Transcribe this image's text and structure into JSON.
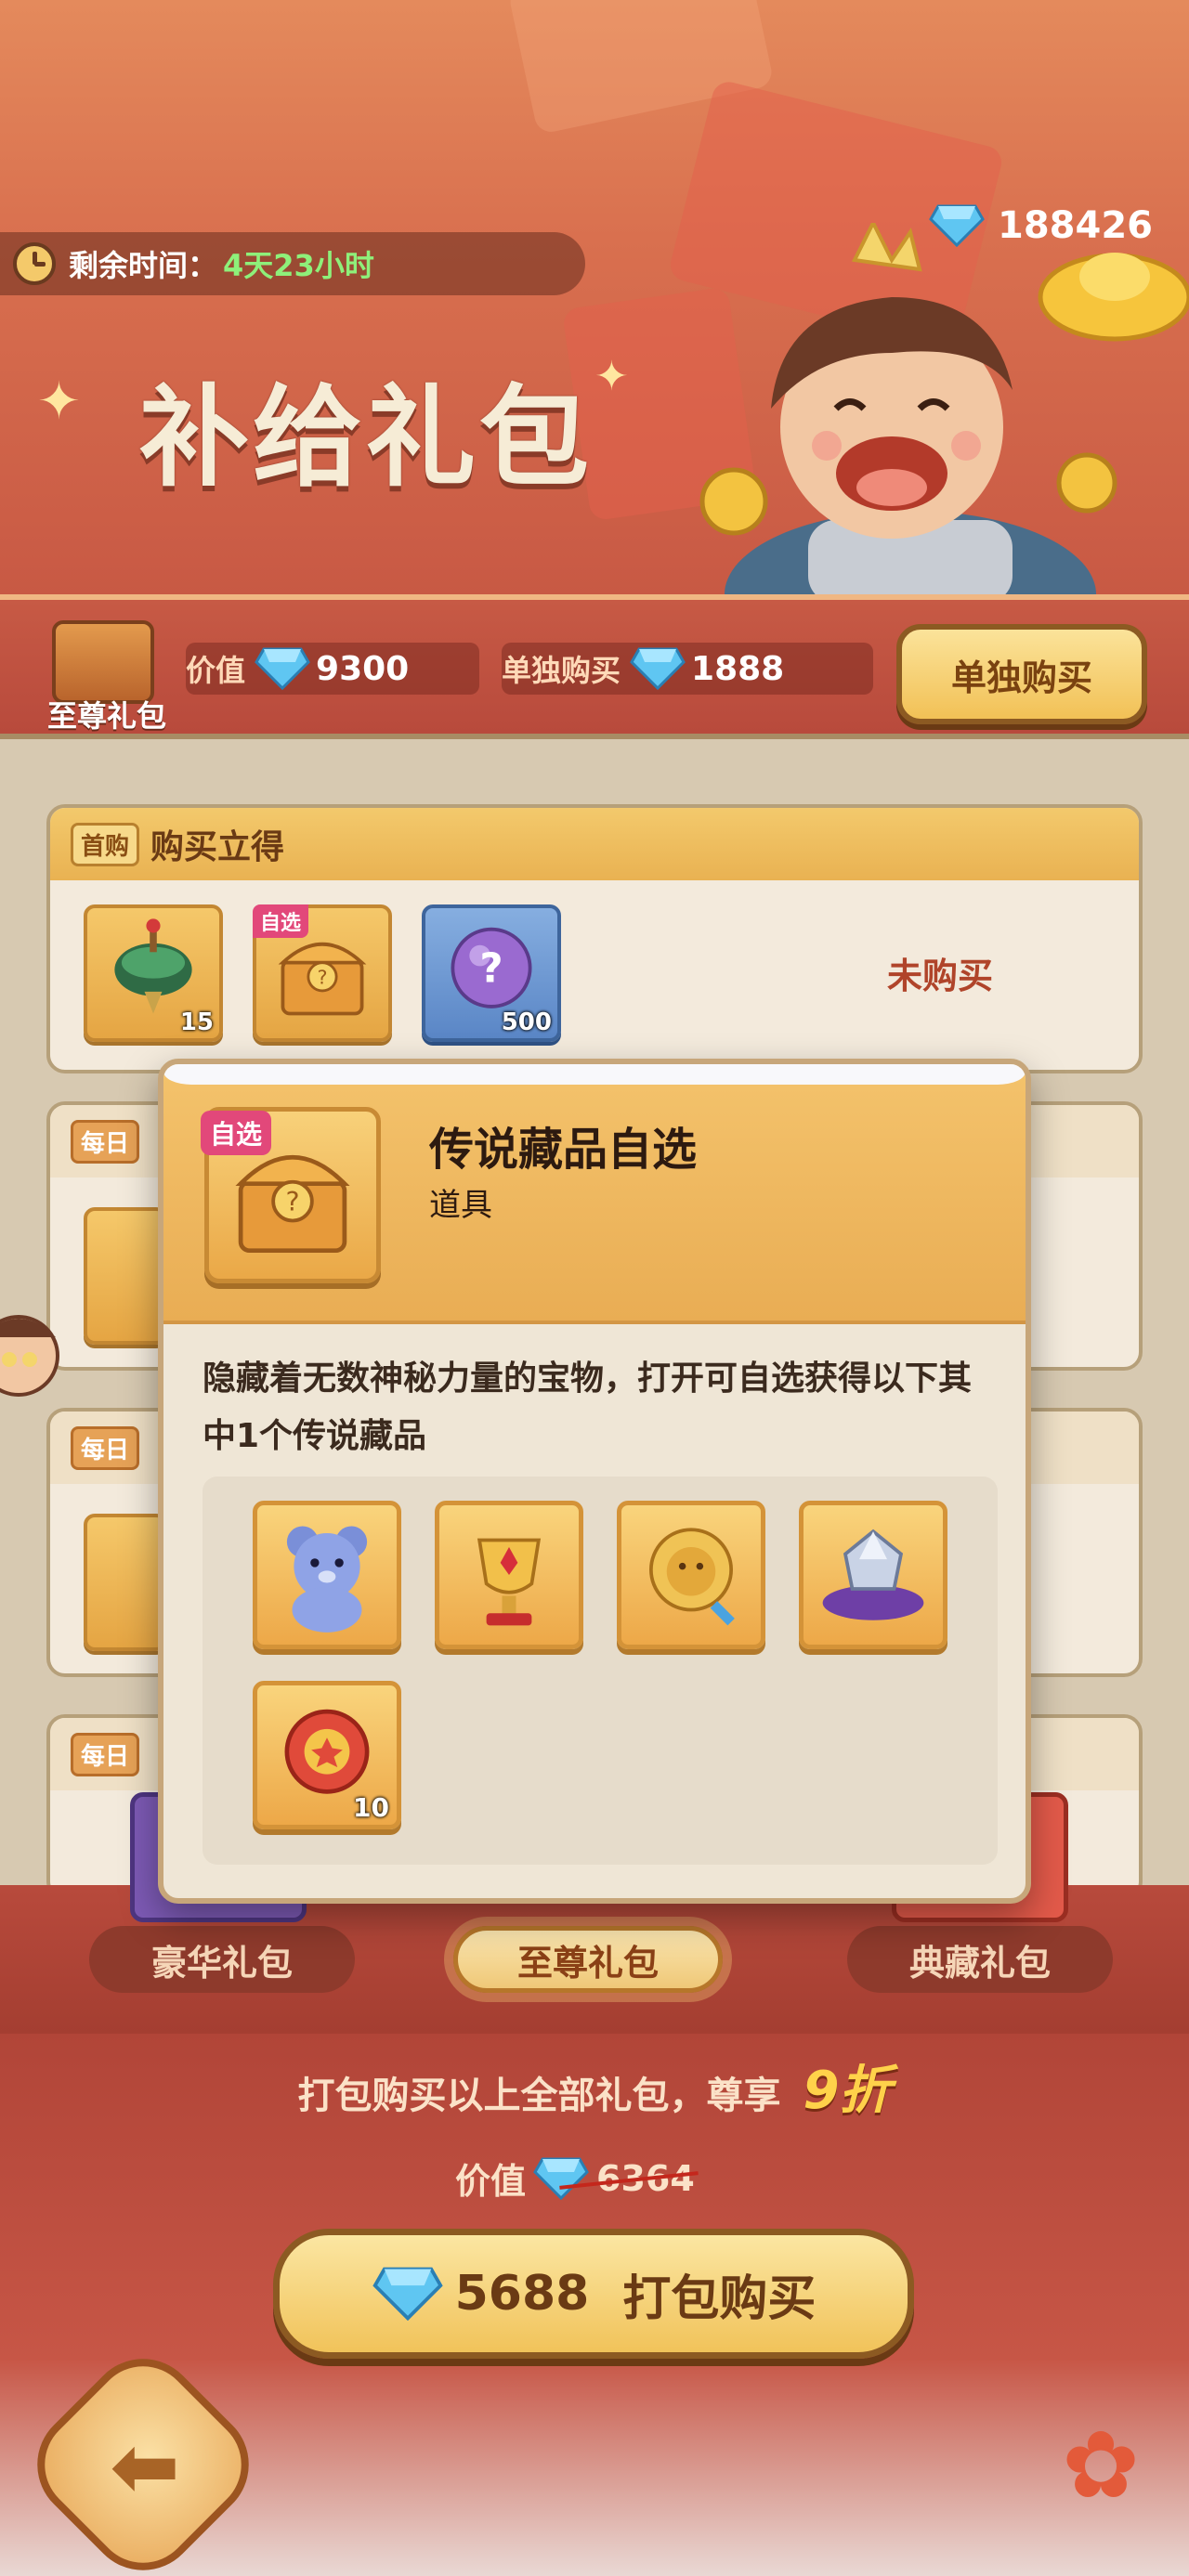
{
  "header": {
    "timer_label": "剩余时间：",
    "timer_value": "4天23小时",
    "gems": "188426",
    "title": "补给礼包"
  },
  "pack": {
    "name": "至尊礼包",
    "value_label": "价值",
    "value_amount": "9300",
    "single_label": "单独购买",
    "single_amount": "1888",
    "single_buy_button": "单独购买"
  },
  "sections": {
    "first_purchase_tag": "首购",
    "first_purchase_title": "购买立得",
    "daily_tag": "每日",
    "status": "未购买",
    "items": [
      {
        "icon": "spinning-top-icon",
        "count": "15"
      },
      {
        "icon": "chest-icon",
        "tag": "自选"
      },
      {
        "icon": "mystery-orb-icon",
        "count": "500"
      }
    ]
  },
  "popup": {
    "tag": "自选",
    "title": "传说藏品自选",
    "subtitle": "道具",
    "description": "隐藏着无数神秘力量的宝物，打开可自选获得以下其中1个传说藏品",
    "rewards": [
      {
        "icon": "teddy-bear-icon"
      },
      {
        "icon": "trophy-icon"
      },
      {
        "icon": "lion-crest-icon"
      },
      {
        "icon": "crystal-cushion-icon"
      },
      {
        "icon": "coin-token-icon",
        "count": "10"
      }
    ]
  },
  "tabs": {
    "deluxe": "豪华礼包",
    "supreme": "至尊礼包",
    "collector": "典藏礼包"
  },
  "bundle": {
    "text": "打包购买以上全部礼包，尊享",
    "discount": "9折",
    "value_label": "价值",
    "old_price": "6364",
    "price": "5688",
    "buy_label": "打包购买"
  },
  "colors": {
    "accent": "#f1c35a",
    "banner": "#d9704f",
    "timer_green": "#8ef07a",
    "tag_pink": "#e2487a"
  }
}
